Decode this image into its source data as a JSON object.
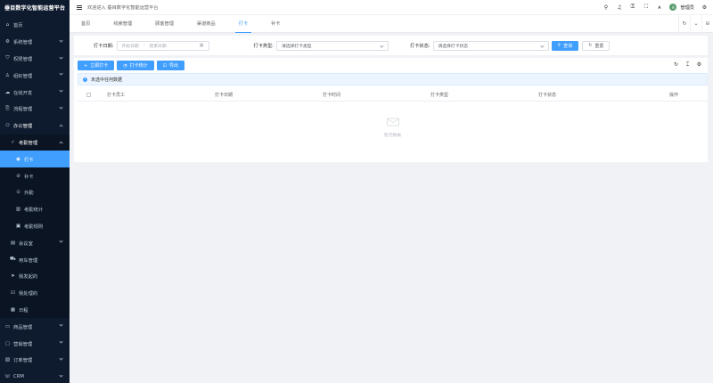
{
  "brand": "垂目数字化智能运营平台",
  "header": {
    "welcome": "欢迎进入 垂目数字化智能运营平台",
    "user": "管理员",
    "avatar_letter": "A"
  },
  "sidebar": {
    "items": [
      {
        "label": "首页",
        "icon": "home-icon"
      },
      {
        "label": "系统管理",
        "icon": "gear-icon"
      },
      {
        "label": "权限管理",
        "icon": "shield-icon"
      },
      {
        "label": "组织管理",
        "icon": "org-icon"
      },
      {
        "label": "在线开发",
        "icon": "cloud-icon"
      },
      {
        "label": "流程管理",
        "icon": "flow-icon"
      },
      {
        "label": "办公管理",
        "icon": "office-icon"
      }
    ],
    "office": {
      "attendance": "考勤管理",
      "punch": "打卡",
      "makeup": "补卡",
      "outing": "外勤",
      "stats": "考勤统计",
      "rules": "考勤规则",
      "meeting": "会议室",
      "car": "用车管理",
      "my_initiated": "我发起的",
      "my_handled": "我处理的",
      "schedule": "日程"
    },
    "bottom": [
      "商品管理",
      "营销管理",
      "订单管理",
      "CRM"
    ]
  },
  "tabs": [
    "首页",
    "线索管理",
    "顾客管理",
    "渠道商品",
    "打卡",
    "补卡"
  ],
  "active_tab": "打卡",
  "search": {
    "date_label": "打卡日期:",
    "start_placeholder": "开始日期",
    "separator": "-",
    "end_placeholder": "结束日期",
    "type_label": "打卡类型:",
    "type_placeholder": "请选择打卡类型",
    "status_label": "打卡状态:",
    "status_placeholder": "请选择打卡状态",
    "search_btn": "查询",
    "reset_btn": "重置"
  },
  "toolbar": {
    "punch_btn": "立即打卡",
    "stats_btn": "打卡统计",
    "export_btn": "导出"
  },
  "alert": "未选中任何数据",
  "table": {
    "columns": [
      "打卡员工",
      "打卡日期",
      "打卡时间",
      "打卡类型",
      "打卡状态",
      "操作"
    ],
    "empty_text": "暂无数据"
  }
}
